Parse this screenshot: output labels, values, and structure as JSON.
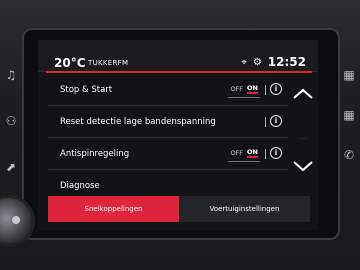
{
  "status_bar": {
    "temperature": "20°C",
    "radio_station": "TUKKERFM",
    "clock": "12:52",
    "icons": [
      "location-pin-icon",
      "settings-gear-icon"
    ]
  },
  "settings_list": [
    {
      "label": "Stop & Start",
      "toggle": {
        "off": "OFF",
        "on": "ON",
        "state": "on"
      },
      "info": "i"
    },
    {
      "label": "Reset detectie lage bandenspanning",
      "info": "i"
    },
    {
      "label": "Antispinregeling",
      "toggle": {
        "off": "OFF",
        "on": "ON",
        "state": "on"
      },
      "info": "i"
    },
    {
      "label": "Diagnose"
    }
  ],
  "scroll": {
    "up_icon": "chevron-up-icon",
    "down_icon": "chevron-down-icon",
    "dots": "···"
  },
  "bottom_tabs": [
    {
      "label": "Snelkoppelingen",
      "active": true
    },
    {
      "label": "Voertuiginstellingen",
      "active": false
    }
  ],
  "colors": {
    "accent": "#e0243b",
    "background": "#121316"
  }
}
